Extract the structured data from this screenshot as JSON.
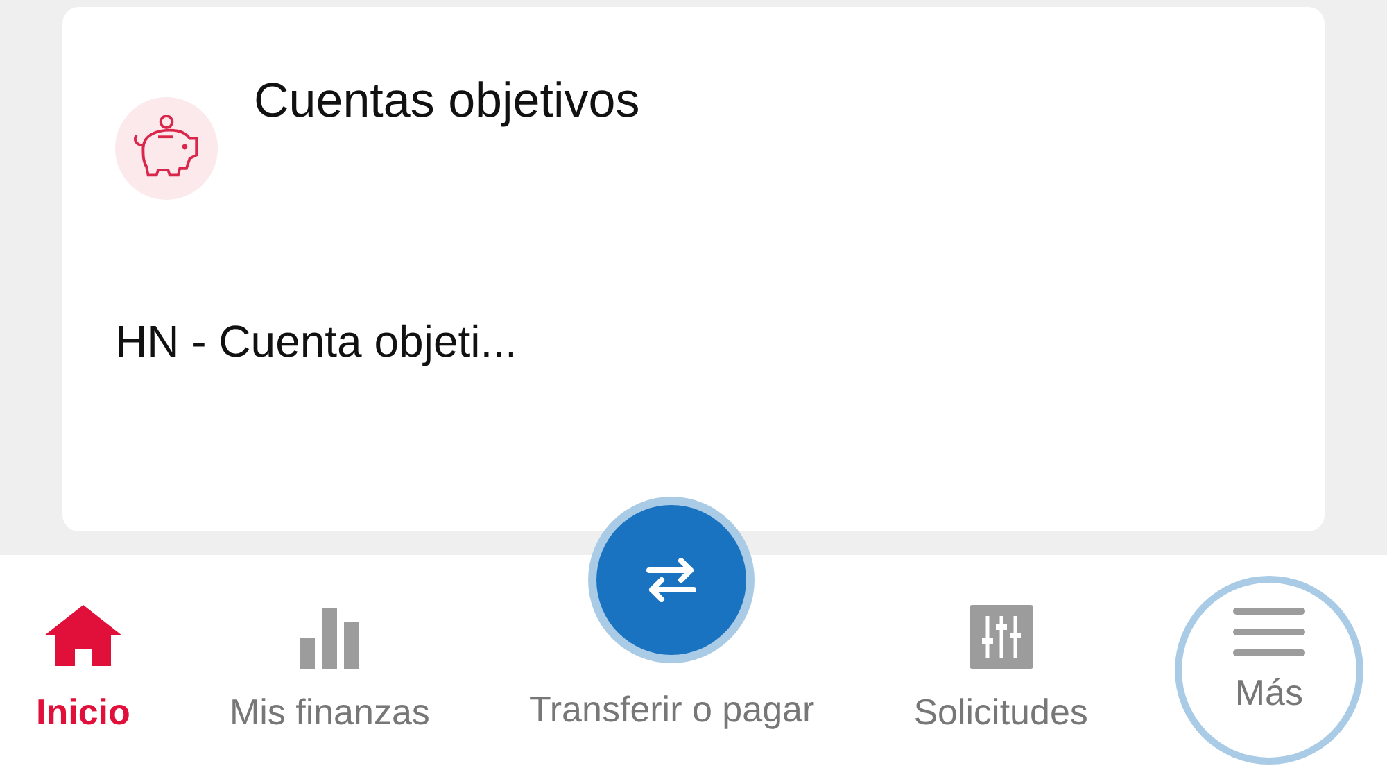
{
  "card": {
    "title": "Cuentas objetivos",
    "account": "HN - Cuenta objeti..."
  },
  "nav": [
    {
      "kind": "home",
      "label": "Inicio",
      "selected": true,
      "highlighted": false
    },
    {
      "kind": "chart",
      "label": "Mis finanzas",
      "selected": false,
      "highlighted": false
    },
    {
      "kind": "transfer",
      "label": "Transferir o pagar",
      "selected": false,
      "highlighted": false
    },
    {
      "kind": "sliders",
      "label": "Solicitudes",
      "selected": false,
      "highlighted": false
    },
    {
      "kind": "menu",
      "label": "Más",
      "selected": false,
      "highlighted": true
    }
  ]
}
